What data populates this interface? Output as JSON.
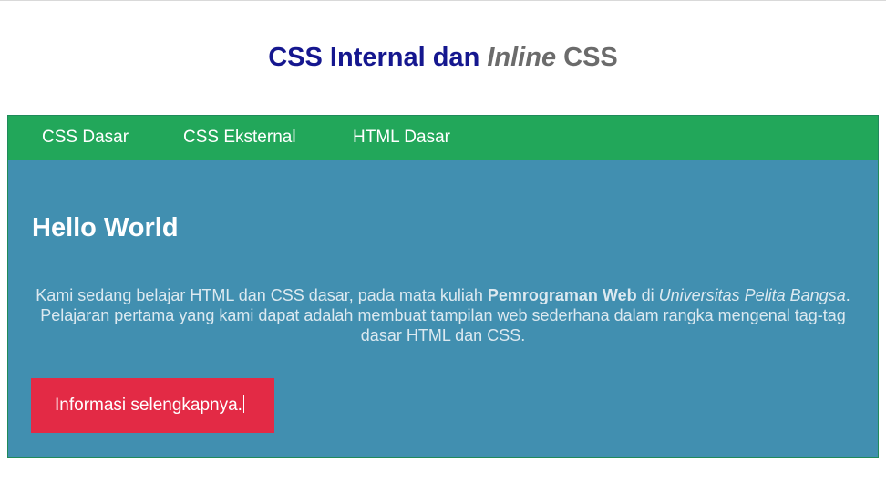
{
  "header": {
    "title_prefix": "CSS Internal dan ",
    "title_inline": "Inline",
    "title_suffix": " CSS"
  },
  "nav": {
    "items": [
      {
        "label": "CSS Dasar"
      },
      {
        "label": "CSS Eksternal"
      },
      {
        "label": "HTML Dasar"
      }
    ]
  },
  "hero": {
    "title": "Hello World",
    "text_part1": "Kami sedang belajar HTML dan CSS dasar, pada mata kuliah ",
    "text_bold": "Pemrograman Web",
    "text_part2": " di ",
    "text_italic": "Universitas Pelita Bangsa",
    "text_part3": ". Pelajaran pertama yang kami dapat adalah membuat tampilan web sederhana dalam rangka mengenal tag-tag dasar HTML dan CSS.",
    "button_label": "Informasi selengkapnya."
  },
  "colors": {
    "title_blue": "#15178f",
    "title_gray": "#6b6b6b",
    "nav_green": "#22a75a",
    "hero_blue": "#418fb0",
    "button_red": "#e32a45"
  }
}
